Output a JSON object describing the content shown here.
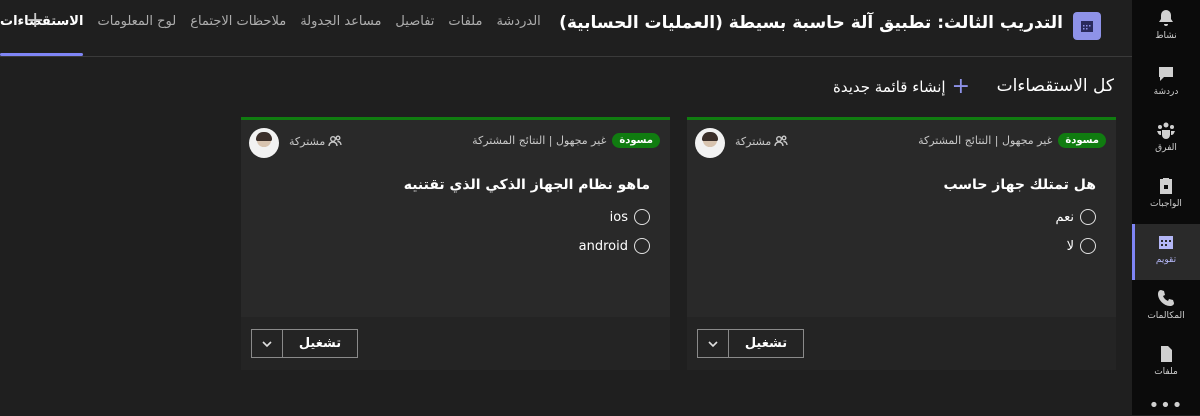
{
  "rail": {
    "items": [
      {
        "label": "نشاط",
        "icon": "bell-icon"
      },
      {
        "label": "دردشة",
        "icon": "chat-icon"
      },
      {
        "label": "الفرق",
        "icon": "teams-icon"
      },
      {
        "label": "الواجبات",
        "icon": "assignments-icon"
      },
      {
        "label": "تقويم",
        "icon": "calendar-icon"
      },
      {
        "label": "المكالمات",
        "icon": "phone-icon"
      },
      {
        "label": "ملفات",
        "icon": "file-icon"
      }
    ],
    "active_index": 4,
    "more_label": "•••"
  },
  "header": {
    "title": "التدريب الثالث: تطبيق آلة حاسبة بسيطة (العمليات الحسابية)",
    "tabs": [
      {
        "label": "الدردشة"
      },
      {
        "label": "ملفات"
      },
      {
        "label": "تفاصيل"
      },
      {
        "label": "مساعد الجدولة"
      },
      {
        "label": "ملاحظات الاجتماع"
      },
      {
        "label": "لوح المعلومات"
      },
      {
        "label": "الاستقصاءات"
      }
    ],
    "active_tab": 6,
    "add_tab_symbol": "+"
  },
  "toolbar": {
    "all_polls": "كل الاستقصاءات",
    "new_list": "إنشاء قائمة جديدة",
    "plus": "+"
  },
  "cards": [
    {
      "status": "مسودة",
      "meta": "غير مجهول | النتائج المشتركة",
      "shared": "مشتركة",
      "question": "هل تمتلك جهاز حاسب",
      "options": [
        "نعم",
        "لا"
      ],
      "run": "تشغيل"
    },
    {
      "status": "مسودة",
      "meta": "غير مجهول | النتائج المشتركة",
      "shared": "مشتركة",
      "question": "ماهو نظام الجهاز الذكي الذي تقتنيه",
      "options": [
        "ios",
        "android"
      ],
      "run": "تشغيل"
    }
  ],
  "colors": {
    "accent": "#7f85f5",
    "draft_badge": "#107c10",
    "background": "#1f1f1f"
  }
}
